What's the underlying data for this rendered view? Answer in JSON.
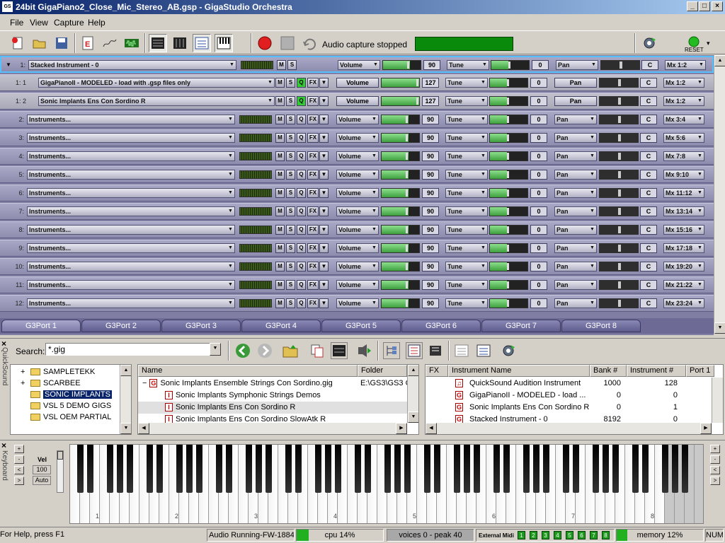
{
  "window": {
    "title": "24bit GigaPiano2_Close_Mic_Stereo_AB.gsp - GigaStudio Orchestra",
    "icon_text": "GS",
    "min": "_",
    "max": "□",
    "close": "×"
  },
  "menu": [
    "File",
    "View",
    "Capture",
    "Help"
  ],
  "toolbar": {
    "capture_status": "Audio capture stopped",
    "reset_label": "RESET",
    "reset_arrow": "▾",
    "accent": "#0a8a0a"
  },
  "tracks": [
    {
      "num": "1:",
      "name": "Stacked Instrument - 0",
      "volume_label": "Volume",
      "volume": 90,
      "tune_label": "Tune",
      "tune": 0,
      "pan_label": "Pan",
      "center": "C",
      "mix": "Mx 1:2",
      "m": "M",
      "s": "S",
      "stack_arrow": "▼"
    },
    {
      "num": "1: 1",
      "name": "GigaPianoII - MODELED - load with .gsp files only",
      "volume_label": "Volume",
      "volume": 127,
      "tune_label": "Tune",
      "tune": 0,
      "pan_label": "Pan",
      "center": "C",
      "mix": "Mx 1:2",
      "m": "M",
      "s": "S",
      "q": "Q",
      "fx": "FX"
    },
    {
      "num": "1: 2",
      "name": "Sonic Implants Ens Con Sordino R",
      "volume_label": "Volume",
      "volume": 127,
      "tune_label": "Tune",
      "tune": 0,
      "pan_label": "Pan",
      "center": "C",
      "mix": "Mx 1:2",
      "m": "M",
      "s": "S",
      "q": "Q",
      "fx": "FX"
    },
    {
      "num": "2:",
      "name": "Instruments...",
      "volume_label": "Volume",
      "volume": 90,
      "tune_label": "Tune",
      "tune": 0,
      "pan_label": "Pan",
      "center": "C",
      "mix": "Mx 3:4",
      "m": "M",
      "s": "S",
      "q": "Q",
      "fx": "FX"
    },
    {
      "num": "3:",
      "name": "Instruments...",
      "volume_label": "Volume",
      "volume": 90,
      "tune_label": "Tune",
      "tune": 0,
      "pan_label": "Pan",
      "center": "C",
      "mix": "Mx 5:6",
      "m": "M",
      "s": "S",
      "q": "Q",
      "fx": "FX"
    },
    {
      "num": "4:",
      "name": "Instruments...",
      "volume_label": "Volume",
      "volume": 90,
      "tune_label": "Tune",
      "tune": 0,
      "pan_label": "Pan",
      "center": "C",
      "mix": "Mx 7:8",
      "m": "M",
      "s": "S",
      "q": "Q",
      "fx": "FX"
    },
    {
      "num": "5:",
      "name": "Instruments...",
      "volume_label": "Volume",
      "volume": 90,
      "tune_label": "Tune",
      "tune": 0,
      "pan_label": "Pan",
      "center": "C",
      "mix": "Mx 9:10",
      "m": "M",
      "s": "S",
      "q": "Q",
      "fx": "FX"
    },
    {
      "num": "6:",
      "name": "Instruments...",
      "volume_label": "Volume",
      "volume": 90,
      "tune_label": "Tune",
      "tune": 0,
      "pan_label": "Pan",
      "center": "C",
      "mix": "Mx 11:12",
      "m": "M",
      "s": "S",
      "q": "Q",
      "fx": "FX"
    },
    {
      "num": "7:",
      "name": "Instruments...",
      "volume_label": "Volume",
      "volume": 90,
      "tune_label": "Tune",
      "tune": 0,
      "pan_label": "Pan",
      "center": "C",
      "mix": "Mx 13:14",
      "m": "M",
      "s": "S",
      "q": "Q",
      "fx": "FX"
    },
    {
      "num": "8:",
      "name": "Instruments...",
      "volume_label": "Volume",
      "volume": 90,
      "tune_label": "Tune",
      "tune": 0,
      "pan_label": "Pan",
      "center": "C",
      "mix": "Mx 15:16",
      "m": "M",
      "s": "S",
      "q": "Q",
      "fx": "FX"
    },
    {
      "num": "9:",
      "name": "Instruments...",
      "volume_label": "Volume",
      "volume": 90,
      "tune_label": "Tune",
      "tune": 0,
      "pan_label": "Pan",
      "center": "C",
      "mix": "Mx 17:18",
      "m": "M",
      "s": "S",
      "q": "Q",
      "fx": "FX"
    },
    {
      "num": "10:",
      "name": "Instruments...",
      "volume_label": "Volume",
      "volume": 90,
      "tune_label": "Tune",
      "tune": 0,
      "pan_label": "Pan",
      "center": "C",
      "mix": "Mx 19:20",
      "m": "M",
      "s": "S",
      "q": "Q",
      "fx": "FX"
    },
    {
      "num": "11:",
      "name": "Instruments...",
      "volume_label": "Volume",
      "volume": 90,
      "tune_label": "Tune",
      "tune": 0,
      "pan_label": "Pan",
      "center": "C",
      "mix": "Mx 21:22",
      "m": "M",
      "s": "S",
      "q": "Q",
      "fx": "FX"
    },
    {
      "num": "12:",
      "name": "Instruments...",
      "volume_label": "Volume",
      "volume": 90,
      "tune_label": "Tune",
      "tune": 0,
      "pan_label": "Pan",
      "center": "C",
      "mix": "Mx 23:24",
      "m": "M",
      "s": "S",
      "q": "Q",
      "fx": "FX"
    }
  ],
  "ports": [
    "G3Port 1",
    "G3Port 2",
    "G3Port 3",
    "G3Port 4",
    "G3Port 5",
    "G3Port 6",
    "G3Port 7",
    "G3Port 8"
  ],
  "quicksound": {
    "tab_label": "QuickSound",
    "close": "×",
    "search_label": "Search:",
    "search_value": "*.gig",
    "tree": [
      {
        "expander": "+",
        "label": "SAMPLETEKK"
      },
      {
        "expander": "+",
        "label": "SCARBEE"
      },
      {
        "expander": "",
        "label": "SONIC IMPLANTS"
      },
      {
        "expander": "",
        "label": "VSL 5 DEMO GIGS"
      },
      {
        "expander": "",
        "label": "VSL OEM PARTIAL"
      }
    ],
    "files_headers": {
      "name": "Name",
      "folder": "Folder"
    },
    "files": [
      {
        "expander": "−",
        "icon": "G",
        "name": "Sonic Implants Ensemble Strings Con Sordino.gig",
        "folder": "E:\\GS3\\GS3 G"
      },
      {
        "icon": "I",
        "name": "Sonic Implants Symphonic Strings Demos",
        "folder": ""
      },
      {
        "icon": "I",
        "name": "Sonic Implants Ens Con Sordino R",
        "folder": ""
      },
      {
        "icon": "I",
        "name": "Sonic Implants Ens Con Sordino SlowAtk R",
        "folder": ""
      }
    ],
    "inst_headers": {
      "fx": "FX",
      "name": "Instrument Name",
      "bank": "Bank #",
      "inst": "Instrument #",
      "port": "Port 1"
    },
    "instruments": [
      {
        "icon": "♫",
        "name": "QuickSound Audition Instrument",
        "bank": "1000",
        "inst": "128"
      },
      {
        "icon": "G",
        "name": "GigaPianoII - MODELED - load ...",
        "bank": "0",
        "inst": "0"
      },
      {
        "icon": "G",
        "name": "Sonic Implants Ens Con Sordino R",
        "bank": "0",
        "inst": "1"
      },
      {
        "icon": "G",
        "name": "Stacked Instrument - 0",
        "bank": "8192",
        "inst": "0"
      }
    ]
  },
  "keyboard": {
    "tab_label": "Keyboard",
    "close": "×",
    "vel_label": "Vel",
    "vel_value": "100",
    "auto_label": "Auto",
    "octaves": [
      "1",
      "2",
      "3",
      "4",
      "5",
      "6",
      "7",
      "8"
    ]
  },
  "status": {
    "help": "For Help, press F1",
    "audio": "Audio Running-FW-1884",
    "cpu": "cpu 14%",
    "cpu_level": 0.14,
    "voices": "voices 0 - peak 40",
    "midi_label": "External Midi",
    "midi_ports": [
      "1",
      "2",
      "3",
      "4",
      "5",
      "6",
      "7",
      "8"
    ],
    "memory": "memory 12%",
    "memory_level": 0.12,
    "num": "NUM"
  }
}
